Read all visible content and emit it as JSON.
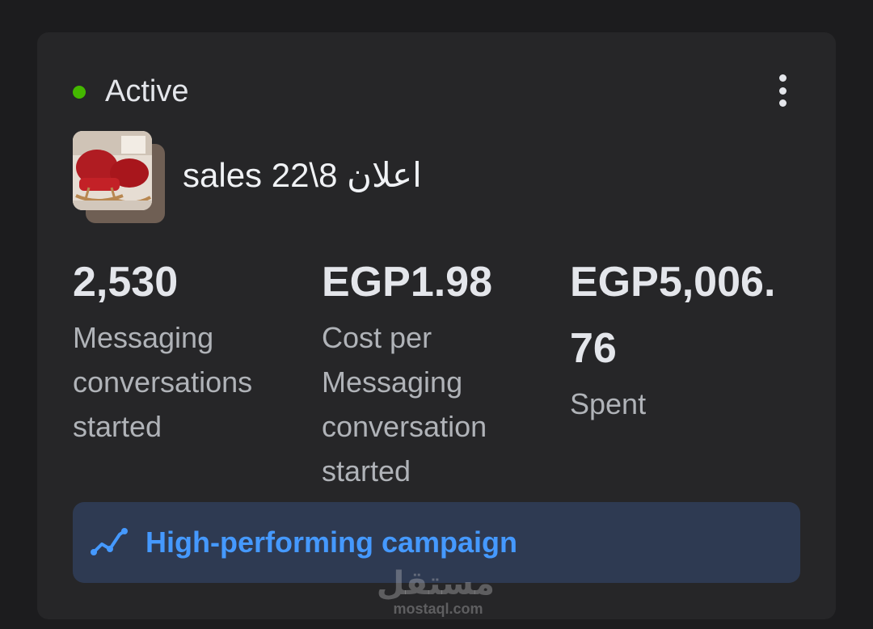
{
  "card": {
    "status": "Active",
    "status_color": "#44b700",
    "ad_name": "sales 22\\8 اعلان",
    "thumbnail_icon": "ad-thumbnail-image",
    "more_icon": "more-vertical-icon"
  },
  "metrics": [
    {
      "value": "2,530",
      "label": "Messaging conversations started"
    },
    {
      "value": "EGP1.98",
      "label": "Cost per Messaging conversation started"
    },
    {
      "value": "EGP5,006.76",
      "label": "Spent"
    }
  ],
  "banner": {
    "icon": "trend-line-icon",
    "text": "High-performing campaign",
    "text_color": "#4599ff"
  },
  "watermark": {
    "arabic": "مستقل",
    "latin": "mostaql.com"
  }
}
